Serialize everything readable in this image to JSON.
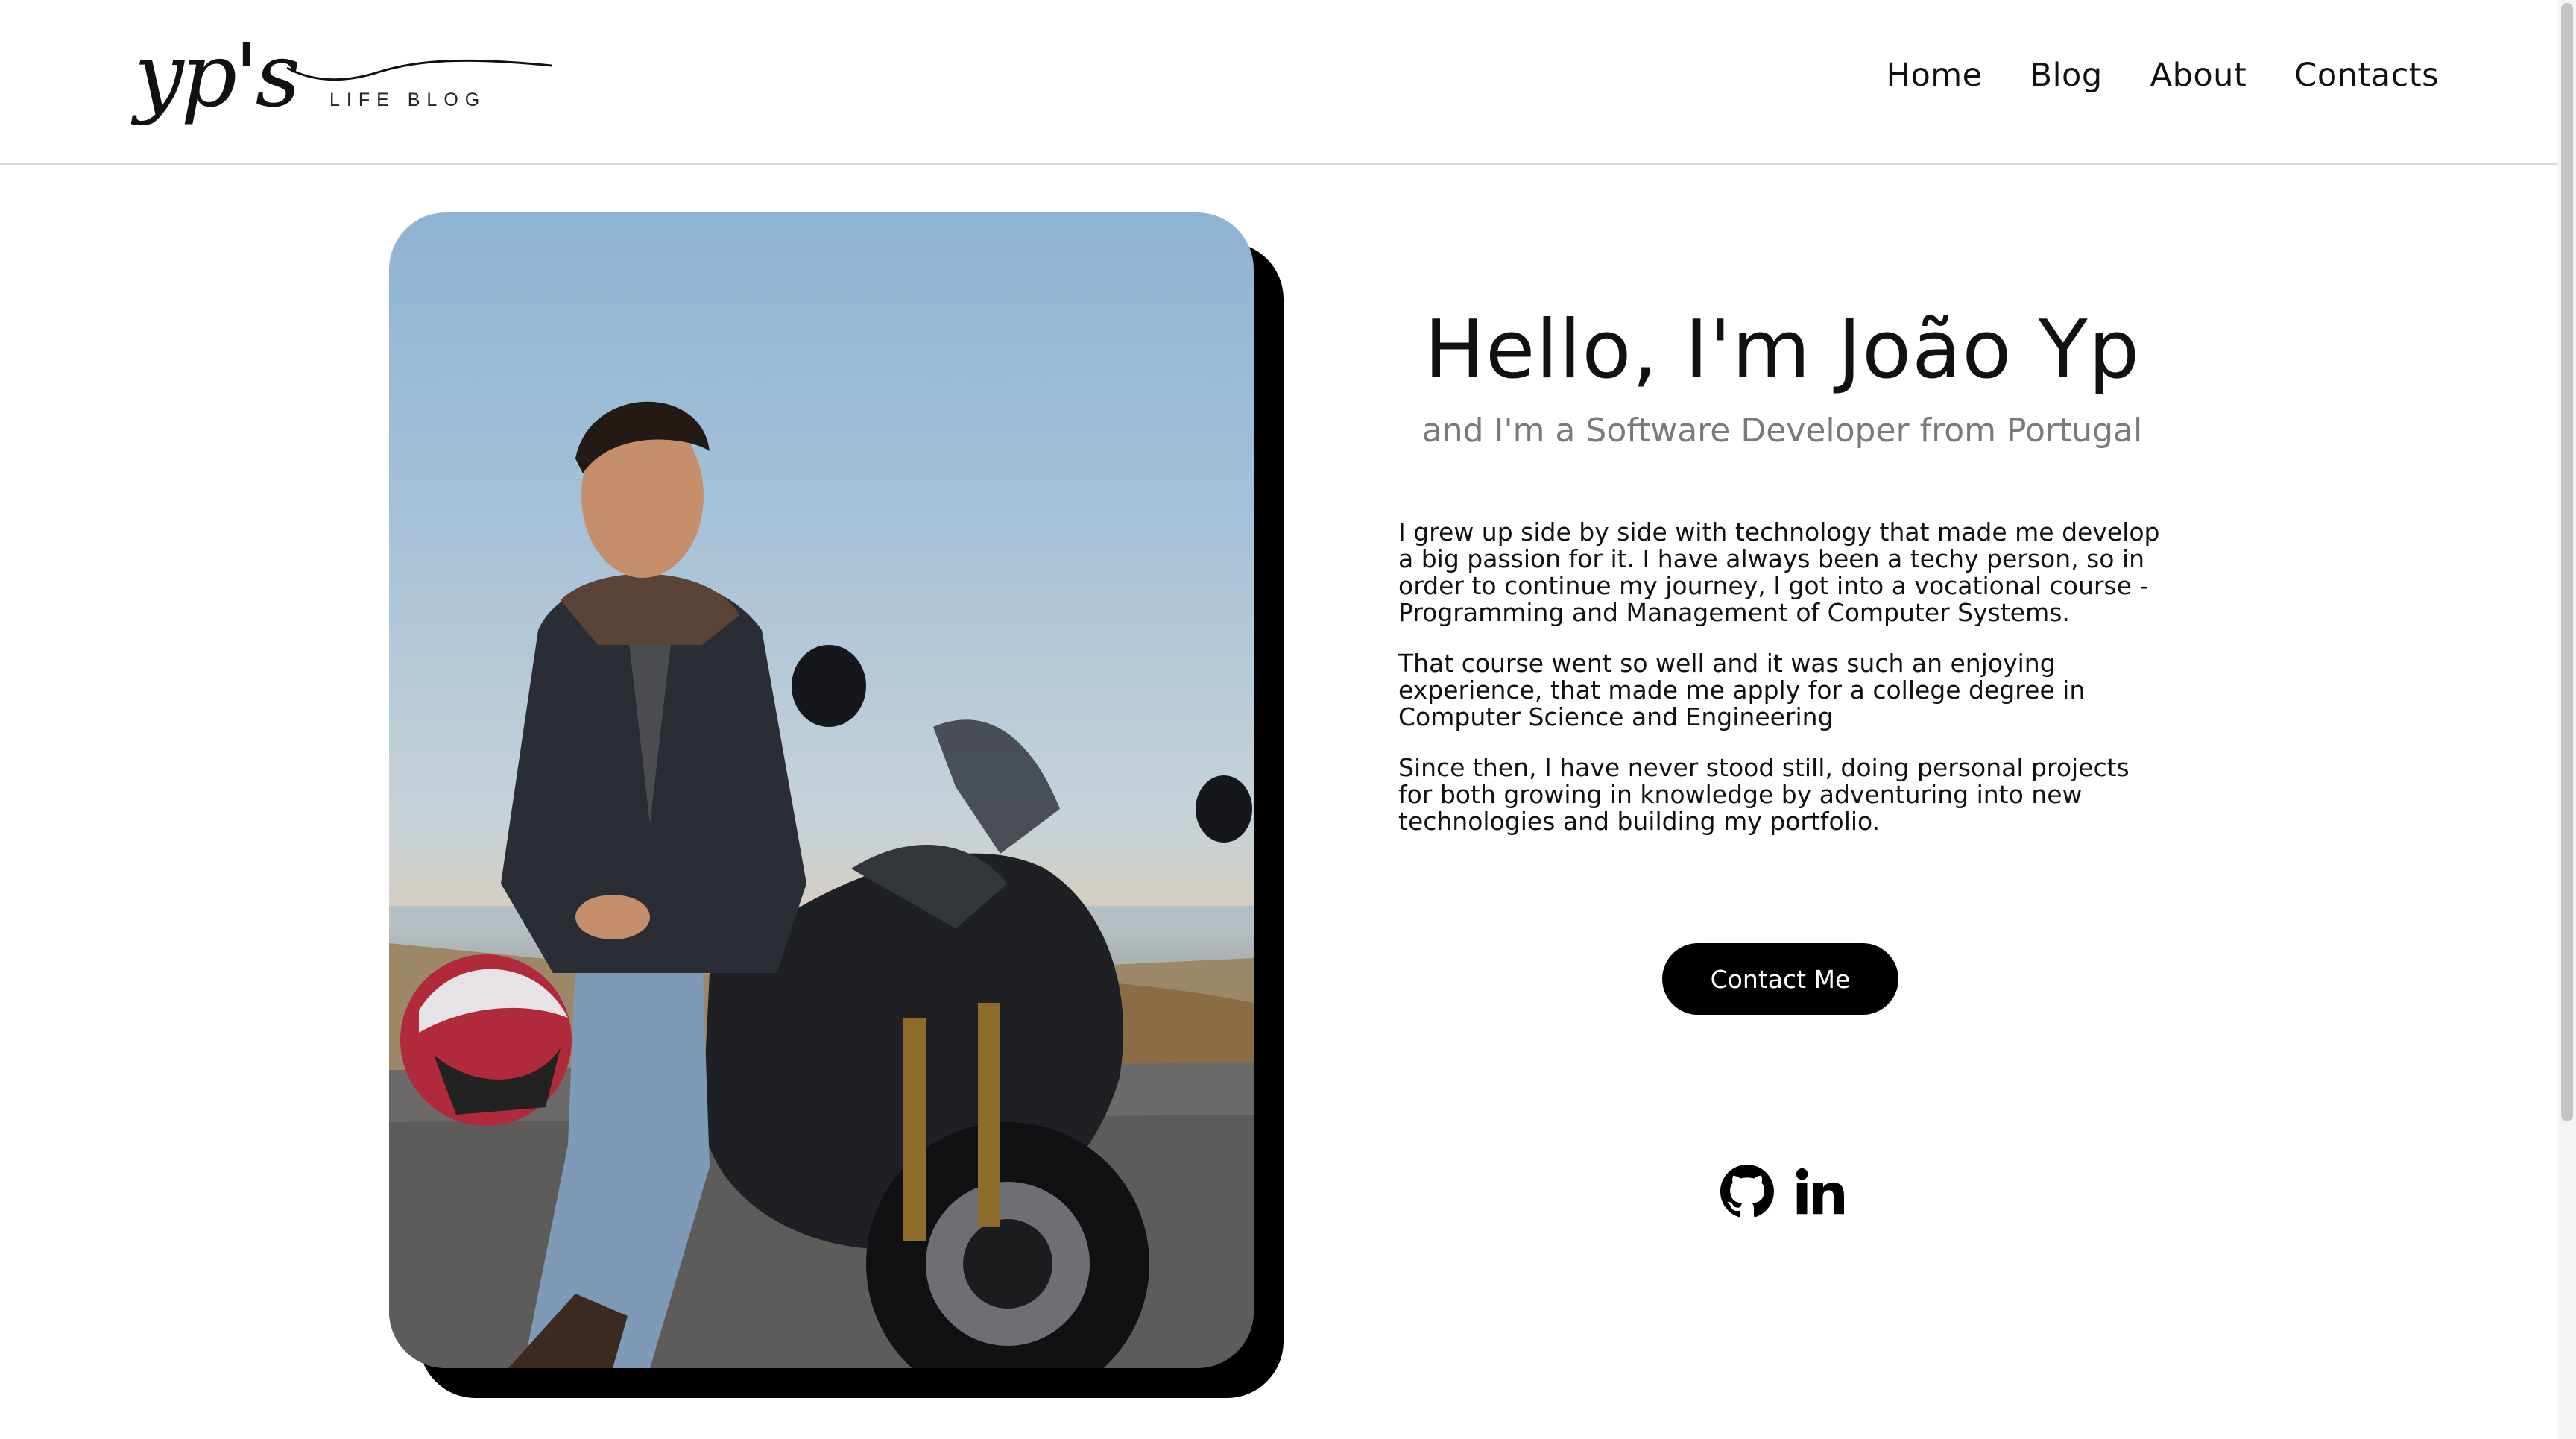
{
  "header": {
    "logo_script": "yp's",
    "logo_sub": "LIFE BLOG",
    "nav": [
      "Home",
      "Blog",
      "About",
      "Contacts"
    ]
  },
  "hero": {
    "photo_alt": "photo-of-man-with-motorcycle",
    "heading": "Hello, I'm João Yp",
    "subtitle": "and I'm a Software Developer from Portugal",
    "bio": [
      "I grew up side by side with technology that made me develop a big passion for it. I have always been a techy person, so in order to continue my journey, I got into a vocational course - Programming and Management of Computer Systems.",
      "That course went so well and it was such an enjoying experience, that made me apply for a college degree in Computer Science and Engineering",
      "Since then, I have never stood still, doing personal projects for both growing in knowledge by adventuring into new technologies and building my portfolio."
    ],
    "contact_button": "Contact Me",
    "socials": [
      "github-icon",
      "linkedin-icon"
    ]
  },
  "colors": {
    "accent": "#000000",
    "subtitle": "#7a7a7a",
    "divider": "#d8d8d8"
  }
}
